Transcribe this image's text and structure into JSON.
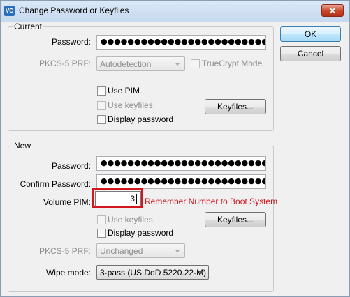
{
  "window": {
    "title": "Change Password or Keyfiles",
    "app_icon_text": "VC",
    "close_glyph": "✕"
  },
  "buttons": {
    "ok": "OK",
    "cancel": "Cancel"
  },
  "current": {
    "group_title": "Current",
    "password_label": "Password:",
    "password_mask": "●●●●●●●●●●●●●●●●●●●●●●●●●●●●●",
    "prf_label": "PKCS-5 PRF:",
    "prf_value": "Autodetection",
    "truecrypt_mode": "TrueCrypt Mode",
    "use_pim": "Use PIM",
    "use_keyfiles": "Use keyfiles",
    "keyfiles_button": "Keyfiles...",
    "display_password": "Display password"
  },
  "new": {
    "group_title": "New",
    "password_label": "Password:",
    "password_mask": "●●●●●●●●●●●●●●●●●●●●●●●●●●●●●",
    "confirm_label": "Confirm Password:",
    "confirm_mask": "●●●●●●●●●●●●●●●●●●●●●●●●●●●●●",
    "pim_label": "Volume PIM:",
    "pim_value": "3",
    "pim_hint": "Remember Number to Boot System",
    "use_keyfiles": "Use keyfiles",
    "keyfiles_button": "Keyfiles...",
    "display_password": "Display password",
    "prf_label": "PKCS-5 PRF:",
    "prf_value": "Unchanged",
    "wipe_label": "Wipe mode:",
    "wipe_value": "3-pass (US DoD 5220.22-M)"
  },
  "colors": {
    "highlight": "#d2161c",
    "dialog_bg": "#f0f0f0"
  },
  "icons": [
    "app-icon",
    "close-icon",
    "chevron-down-icon"
  ]
}
